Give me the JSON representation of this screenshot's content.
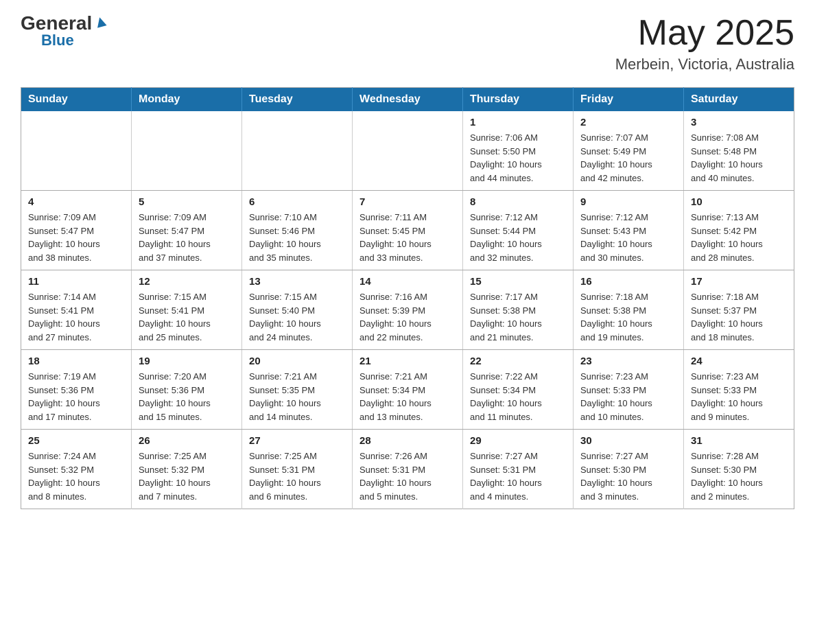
{
  "header": {
    "logo": {
      "general": "General",
      "arrow": "▲",
      "blue": "Blue"
    },
    "title": "May 2025",
    "location": "Merbein, Victoria, Australia"
  },
  "calendar": {
    "days_of_week": [
      "Sunday",
      "Monday",
      "Tuesday",
      "Wednesday",
      "Thursday",
      "Friday",
      "Saturday"
    ],
    "weeks": [
      [
        {
          "day": "",
          "info": ""
        },
        {
          "day": "",
          "info": ""
        },
        {
          "day": "",
          "info": ""
        },
        {
          "day": "",
          "info": ""
        },
        {
          "day": "1",
          "info": "Sunrise: 7:06 AM\nSunset: 5:50 PM\nDaylight: 10 hours\nand 44 minutes."
        },
        {
          "day": "2",
          "info": "Sunrise: 7:07 AM\nSunset: 5:49 PM\nDaylight: 10 hours\nand 42 minutes."
        },
        {
          "day": "3",
          "info": "Sunrise: 7:08 AM\nSunset: 5:48 PM\nDaylight: 10 hours\nand 40 minutes."
        }
      ],
      [
        {
          "day": "4",
          "info": "Sunrise: 7:09 AM\nSunset: 5:47 PM\nDaylight: 10 hours\nand 38 minutes."
        },
        {
          "day": "5",
          "info": "Sunrise: 7:09 AM\nSunset: 5:47 PM\nDaylight: 10 hours\nand 37 minutes."
        },
        {
          "day": "6",
          "info": "Sunrise: 7:10 AM\nSunset: 5:46 PM\nDaylight: 10 hours\nand 35 minutes."
        },
        {
          "day": "7",
          "info": "Sunrise: 7:11 AM\nSunset: 5:45 PM\nDaylight: 10 hours\nand 33 minutes."
        },
        {
          "day": "8",
          "info": "Sunrise: 7:12 AM\nSunset: 5:44 PM\nDaylight: 10 hours\nand 32 minutes."
        },
        {
          "day": "9",
          "info": "Sunrise: 7:12 AM\nSunset: 5:43 PM\nDaylight: 10 hours\nand 30 minutes."
        },
        {
          "day": "10",
          "info": "Sunrise: 7:13 AM\nSunset: 5:42 PM\nDaylight: 10 hours\nand 28 minutes."
        }
      ],
      [
        {
          "day": "11",
          "info": "Sunrise: 7:14 AM\nSunset: 5:41 PM\nDaylight: 10 hours\nand 27 minutes."
        },
        {
          "day": "12",
          "info": "Sunrise: 7:15 AM\nSunset: 5:41 PM\nDaylight: 10 hours\nand 25 minutes."
        },
        {
          "day": "13",
          "info": "Sunrise: 7:15 AM\nSunset: 5:40 PM\nDaylight: 10 hours\nand 24 minutes."
        },
        {
          "day": "14",
          "info": "Sunrise: 7:16 AM\nSunset: 5:39 PM\nDaylight: 10 hours\nand 22 minutes."
        },
        {
          "day": "15",
          "info": "Sunrise: 7:17 AM\nSunset: 5:38 PM\nDaylight: 10 hours\nand 21 minutes."
        },
        {
          "day": "16",
          "info": "Sunrise: 7:18 AM\nSunset: 5:38 PM\nDaylight: 10 hours\nand 19 minutes."
        },
        {
          "day": "17",
          "info": "Sunrise: 7:18 AM\nSunset: 5:37 PM\nDaylight: 10 hours\nand 18 minutes."
        }
      ],
      [
        {
          "day": "18",
          "info": "Sunrise: 7:19 AM\nSunset: 5:36 PM\nDaylight: 10 hours\nand 17 minutes."
        },
        {
          "day": "19",
          "info": "Sunrise: 7:20 AM\nSunset: 5:36 PM\nDaylight: 10 hours\nand 15 minutes."
        },
        {
          "day": "20",
          "info": "Sunrise: 7:21 AM\nSunset: 5:35 PM\nDaylight: 10 hours\nand 14 minutes."
        },
        {
          "day": "21",
          "info": "Sunrise: 7:21 AM\nSunset: 5:34 PM\nDaylight: 10 hours\nand 13 minutes."
        },
        {
          "day": "22",
          "info": "Sunrise: 7:22 AM\nSunset: 5:34 PM\nDaylight: 10 hours\nand 11 minutes."
        },
        {
          "day": "23",
          "info": "Sunrise: 7:23 AM\nSunset: 5:33 PM\nDaylight: 10 hours\nand 10 minutes."
        },
        {
          "day": "24",
          "info": "Sunrise: 7:23 AM\nSunset: 5:33 PM\nDaylight: 10 hours\nand 9 minutes."
        }
      ],
      [
        {
          "day": "25",
          "info": "Sunrise: 7:24 AM\nSunset: 5:32 PM\nDaylight: 10 hours\nand 8 minutes."
        },
        {
          "day": "26",
          "info": "Sunrise: 7:25 AM\nSunset: 5:32 PM\nDaylight: 10 hours\nand 7 minutes."
        },
        {
          "day": "27",
          "info": "Sunrise: 7:25 AM\nSunset: 5:31 PM\nDaylight: 10 hours\nand 6 minutes."
        },
        {
          "day": "28",
          "info": "Sunrise: 7:26 AM\nSunset: 5:31 PM\nDaylight: 10 hours\nand 5 minutes."
        },
        {
          "day": "29",
          "info": "Sunrise: 7:27 AM\nSunset: 5:31 PM\nDaylight: 10 hours\nand 4 minutes."
        },
        {
          "day": "30",
          "info": "Sunrise: 7:27 AM\nSunset: 5:30 PM\nDaylight: 10 hours\nand 3 minutes."
        },
        {
          "day": "31",
          "info": "Sunrise: 7:28 AM\nSunset: 5:30 PM\nDaylight: 10 hours\nand 2 minutes."
        }
      ]
    ]
  }
}
